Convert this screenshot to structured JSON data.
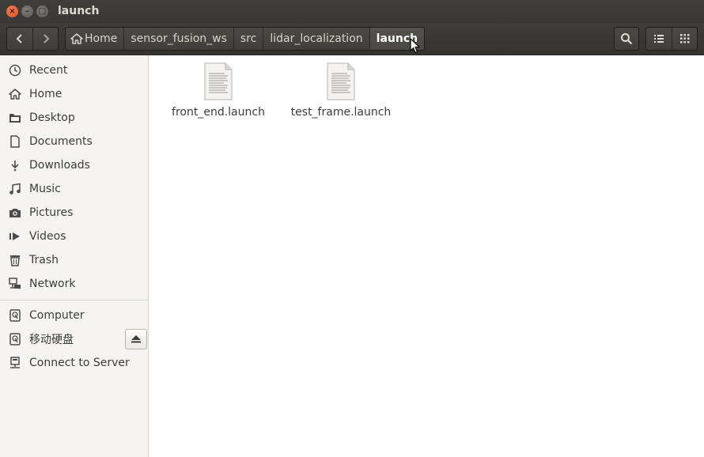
{
  "window": {
    "title": "launch",
    "close_glyph": "×",
    "min_glyph": "–",
    "max_glyph": "□"
  },
  "toolbar": {
    "back_icon": "chevron-left-icon",
    "forward_icon": "chevron-right-icon",
    "breadcrumbs": [
      {
        "label": "Home",
        "icon": "home-icon"
      },
      {
        "label": "sensor_fusion_ws"
      },
      {
        "label": "src"
      },
      {
        "label": "lidar_localization"
      },
      {
        "label": "launch",
        "active": true
      }
    ],
    "search_icon": "search-icon",
    "list_view_icon": "list-view-icon",
    "grid_view_icon": "grid-view-icon"
  },
  "sidebar": {
    "places": [
      {
        "label": "Recent",
        "icon": "recent-icon"
      },
      {
        "label": "Home",
        "icon": "home-icon"
      },
      {
        "label": "Desktop",
        "icon": "desktop-folder-icon"
      },
      {
        "label": "Documents",
        "icon": "document-icon"
      },
      {
        "label": "Downloads",
        "icon": "download-icon"
      },
      {
        "label": "Music",
        "icon": "music-icon"
      },
      {
        "label": "Pictures",
        "icon": "camera-icon"
      },
      {
        "label": "Videos",
        "icon": "video-icon"
      },
      {
        "label": "Trash",
        "icon": "trash-icon"
      },
      {
        "label": "Network",
        "icon": "network-icon"
      }
    ],
    "devices": [
      {
        "label": "Computer",
        "icon": "drive-icon"
      },
      {
        "label": "移动硬盘",
        "icon": "drive-icon",
        "eject": true
      },
      {
        "label": "Connect to Server",
        "icon": "server-icon"
      }
    ]
  },
  "files": [
    {
      "name": "front_end.launch",
      "icon": "text-file-icon"
    },
    {
      "name": "test_frame.launch",
      "icon": "text-file-icon"
    }
  ],
  "colors": {
    "titlebar": "#3c3b37",
    "close_button": "#e9592a",
    "sidebar_bg": "#f5f4f2",
    "text": "#3c3c3c"
  }
}
